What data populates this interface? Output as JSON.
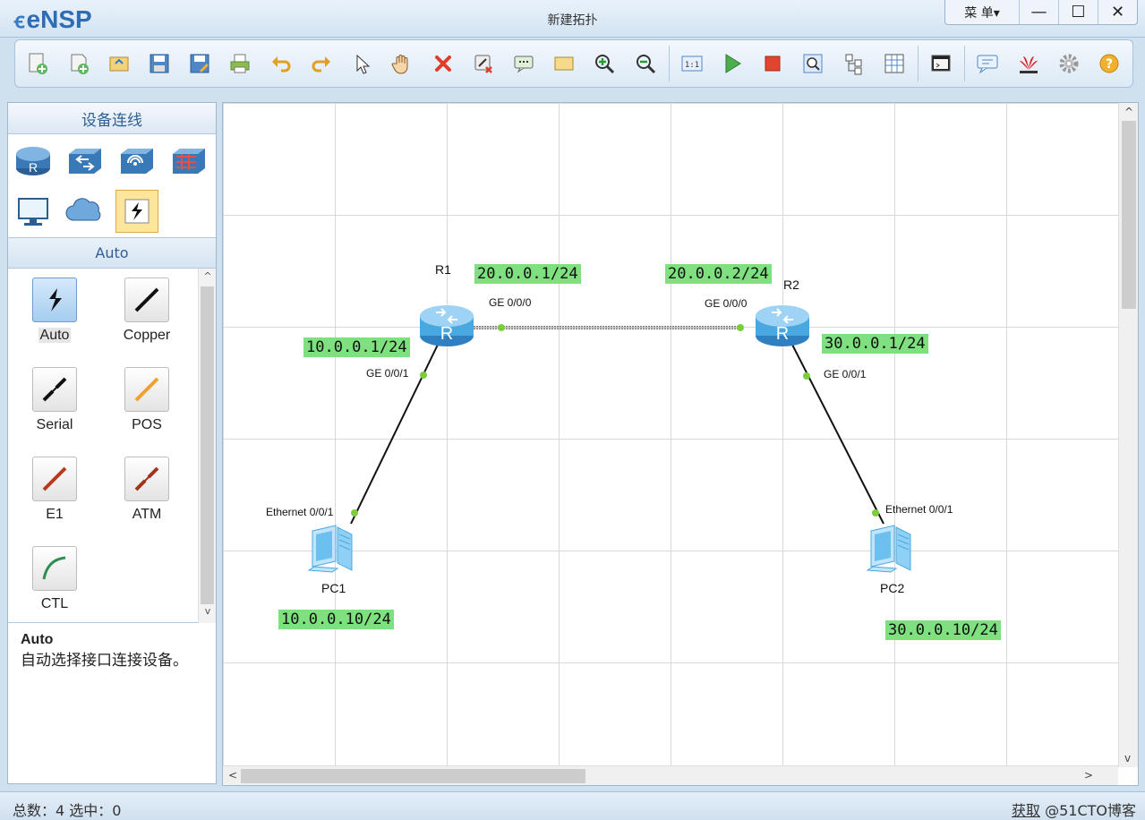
{
  "app": {
    "logo": "eNSP",
    "window_title": "新建拓扑",
    "menu_label": "菜 单▾",
    "minimize": "—",
    "maximize": "☐",
    "close": "✕"
  },
  "toolbar": {
    "icons": [
      "new-topology-icon",
      "new-example-icon",
      "open-icon",
      "save-icon",
      "save-as-icon",
      "print-icon",
      "undo-icon",
      "redo-icon",
      "select-icon",
      "pan-hand-icon",
      "delete-icon",
      "delete-link-icon",
      "text-icon",
      "shape-icon",
      "zoom-in-icon",
      "zoom-out-icon",
      "fit-view-icon",
      "start-device-icon",
      "stop-device-icon",
      "capture-icon",
      "topology-tree-icon",
      "grid-view-icon",
      "console-icon",
      "chat-icon",
      "huawei-icon",
      "settings-icon",
      "help-icon"
    ]
  },
  "left_panel": {
    "title": "设备连线",
    "devices": [
      "router-icon",
      "switch-icon",
      "wireless-icon",
      "firewall-icon",
      "pc-icon",
      "cloud-icon",
      "cable-icon"
    ],
    "subtitle": "Auto",
    "cables": [
      {
        "label": "Auto",
        "icon": "auto-cable-icon",
        "color": "#1a1a1a"
      },
      {
        "label": "Copper",
        "icon": "copper-cable-icon",
        "color": "#111111"
      },
      {
        "label": "Serial",
        "icon": "serial-cable-icon",
        "color": "#111111"
      },
      {
        "label": "POS",
        "icon": "pos-cable-icon",
        "color": "#f0a030"
      },
      {
        "label": "E1",
        "icon": "e1-cable-icon",
        "color": "#b83a1a"
      },
      {
        "label": "ATM",
        "icon": "atm-cable-icon",
        "color": "#a0341c"
      },
      {
        "label": "CTL",
        "icon": "ctl-cable-icon",
        "color": "#2e8f52"
      }
    ],
    "description_title": "Auto",
    "description_text": "自动选择接口连接设备。"
  },
  "topology": {
    "nodes": {
      "r1": {
        "name": "R1"
      },
      "r2": {
        "name": "R2"
      },
      "pc1": {
        "name": "PC1"
      },
      "pc2": {
        "name": "PC2"
      }
    },
    "ip_tags": {
      "r1_ge000": "20.0.0.1/24",
      "r2_ge000": "20.0.0.2/24",
      "r1_ge001": "10.0.0.1/24",
      "r2_ge001": "30.0.0.1/24",
      "pc1": "10.0.0.10/24",
      "pc2": "30.0.0.10/24"
    },
    "ports": {
      "r1_ge000": "GE 0/0/0",
      "r2_ge000": "GE 0/0/0",
      "r1_ge001": "GE 0/0/1",
      "r2_ge001": "GE 0/0/1",
      "pc1_eth": "Ethernet 0/0/1",
      "pc2_eth": "Ethernet 0/0/1"
    },
    "colors": {
      "port_dot": "#7ccd3b",
      "ip_tag_bg": "#7ee07e",
      "router": "#4aa8e0"
    }
  },
  "status": {
    "left": "总数：4  选中：0",
    "right_link": "获取",
    "watermark": "@51CTO博客"
  }
}
